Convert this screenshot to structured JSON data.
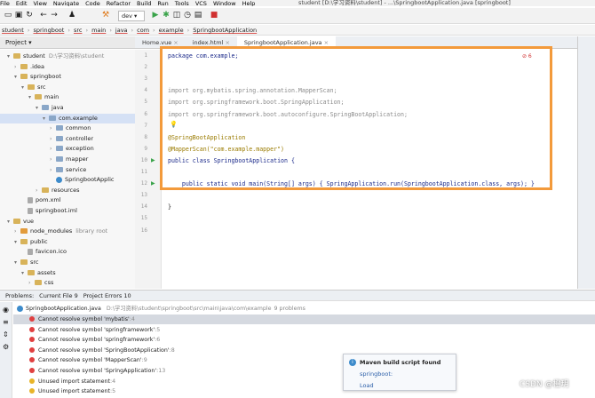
{
  "menubar": {
    "items": [
      "File",
      "Edit",
      "View",
      "Navigate",
      "Code",
      "Refactor",
      "Build",
      "Run",
      "Tools",
      "VCS",
      "Window",
      "Help"
    ],
    "title": "student [D:\\学习资料\\student] - ...\\SpringbootApplication.java [springboot]"
  },
  "toolbar": {
    "run_config": "dev"
  },
  "breadcrumb": [
    "student",
    "springboot",
    "src",
    "main",
    "java",
    "com",
    "example",
    "SpringbootApplication"
  ],
  "project": {
    "header": "Project",
    "rows": [
      {
        "indent": 1,
        "arrow": "▾",
        "icon": "y",
        "label": "student",
        "extra": "D:\\学习资料\\student"
      },
      {
        "indent": 2,
        "arrow": "›",
        "icon": "y",
        "label": ".idea",
        "extra": ""
      },
      {
        "indent": 2,
        "arrow": "▾",
        "icon": "y",
        "label": "springboot",
        "extra": ""
      },
      {
        "indent": 3,
        "arrow": "▾",
        "icon": "y",
        "label": "src",
        "extra": ""
      },
      {
        "indent": 4,
        "arrow": "▾",
        "icon": "y",
        "label": "main",
        "extra": ""
      },
      {
        "indent": 5,
        "arrow": "▾",
        "icon": "",
        "label": "java",
        "extra": ""
      },
      {
        "indent": 6,
        "arrow": "▾",
        "icon": "",
        "label": "com.example",
        "extra": "",
        "sel": true
      },
      {
        "indent": 7,
        "arrow": "›",
        "icon": "",
        "label": "common",
        "extra": ""
      },
      {
        "indent": 7,
        "arrow": "›",
        "icon": "",
        "label": "controller",
        "extra": ""
      },
      {
        "indent": 7,
        "arrow": "›",
        "icon": "",
        "label": "exception",
        "extra": ""
      },
      {
        "indent": 7,
        "arrow": "›",
        "icon": "",
        "label": "mapper",
        "extra": ""
      },
      {
        "indent": 7,
        "arrow": "›",
        "icon": "",
        "label": "service",
        "extra": ""
      },
      {
        "indent": 7,
        "arrow": "",
        "icon": "c",
        "label": "SpringbootApplic",
        "extra": ""
      },
      {
        "indent": 5,
        "arrow": "›",
        "icon": "y",
        "label": "resources",
        "extra": ""
      },
      {
        "indent": 3,
        "arrow": "",
        "icon": "f",
        "label": "pom.xml",
        "extra": ""
      },
      {
        "indent": 3,
        "arrow": "",
        "icon": "f",
        "label": "springboot.iml",
        "extra": ""
      },
      {
        "indent": 1,
        "arrow": "▾",
        "icon": "y",
        "label": "vue",
        "extra": ""
      },
      {
        "indent": 2,
        "arrow": "›",
        "icon": "o",
        "label": "node_modules",
        "extra": "library root"
      },
      {
        "indent": 2,
        "arrow": "▾",
        "icon": "y",
        "label": "public",
        "extra": ""
      },
      {
        "indent": 3,
        "arrow": "",
        "icon": "f",
        "label": "favicon.ico",
        "extra": ""
      },
      {
        "indent": 2,
        "arrow": "▾",
        "icon": "y",
        "label": "src",
        "extra": ""
      },
      {
        "indent": 3,
        "arrow": "▾",
        "icon": "y",
        "label": "assets",
        "extra": ""
      },
      {
        "indent": 4,
        "arrow": "›",
        "icon": "y",
        "label": "css",
        "extra": ""
      }
    ]
  },
  "tabs": [
    {
      "label": "Home.vue",
      "active": false
    },
    {
      "label": "index.html",
      "active": false
    },
    {
      "label": "SpringbootApplication.java",
      "active": true
    }
  ],
  "editor": {
    "line_numbers": [
      "1",
      "2",
      "3",
      "4",
      "5",
      "6",
      "7",
      "8",
      "9",
      "10",
      "11",
      "12",
      "13",
      "14",
      "15",
      "16"
    ],
    "error_badge": "⊘ 6",
    "lines": [
      "package com.example;",
      "",
      "",
      "import org.mybatis.spring.annotation.MapperScan;",
      "import org.springframework.boot.SpringApplication;",
      "import org.springframework.boot.autoconfigure.SpringBootApplication;",
      "",
      "@SpringBootApplication",
      "@MapperScan(\"com.example.mapper\")",
      "public class SpringbootApplication {",
      "",
      "    public static void main(String[] args) { SpringApplication.run(SpringbootApplication.class, args); }",
      "",
      "}",
      "",
      ""
    ]
  },
  "problems": {
    "tabs": [
      "Problems:",
      "Current File 9",
      "Project Errors 10"
    ],
    "file_row": {
      "name": "SpringbootApplication.java",
      "path": "D:\\学习资料\\student\\springboot\\src\\main\\java\\com\\example",
      "count": "9 problems"
    },
    "rows": [
      {
        "kind": "error",
        "text": "Cannot resolve symbol 'mybatis'",
        "loc": ":4",
        "sel": true
      },
      {
        "kind": "error",
        "text": "Cannot resolve symbol 'springframework'",
        "loc": ":5"
      },
      {
        "kind": "error",
        "text": "Cannot resolve symbol 'springframework'",
        "loc": ":6"
      },
      {
        "kind": "error",
        "text": "Cannot resolve symbol 'SpringBootApplication'",
        "loc": ":8"
      },
      {
        "kind": "error",
        "text": "Cannot resolve symbol 'MapperScan'",
        "loc": ":9"
      },
      {
        "kind": "error",
        "text": "Cannot resolve symbol 'SpringApplication'",
        "loc": ":13"
      },
      {
        "kind": "warning",
        "text": "Unused import statement",
        "loc": ":4"
      },
      {
        "kind": "warning",
        "text": "Unused import statement",
        "loc": ":5"
      }
    ]
  },
  "maven_popup": {
    "title": "Maven build script found",
    "module": "springboot:",
    "action": "Load"
  },
  "watermark": "CSDN @橙玥",
  "colors": {
    "accent": "#f39a3b",
    "error": "#e04040",
    "warning": "#e8b428"
  }
}
